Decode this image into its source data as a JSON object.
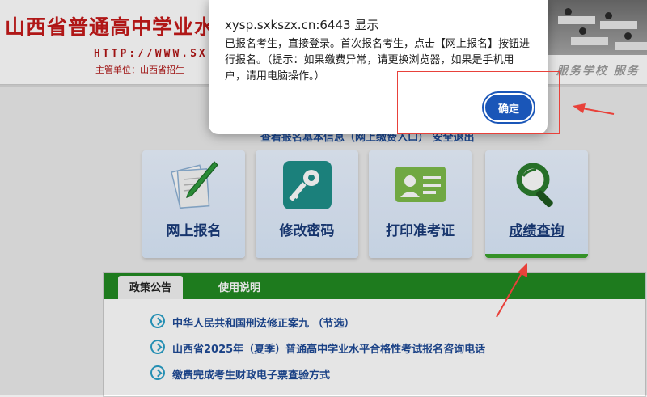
{
  "header": {
    "site_title": "山西省普通高中学业水",
    "site_url": "HTTP://WWW.SX",
    "host_line": "主管单位：山西省招生",
    "slogan": "服务学校  服务"
  },
  "hidden_links": "查看报名基本信息（网上缴费入口）     安全退出",
  "cards": [
    {
      "label": "网上报名",
      "icon": "pen-paper-icon"
    },
    {
      "label": "修改密码",
      "icon": "key-icon"
    },
    {
      "label": "打印准考证",
      "icon": "id-card-icon"
    },
    {
      "label": "成绩查询",
      "icon": "magnifier-icon"
    }
  ],
  "panel": {
    "tabs": [
      "政策公告",
      "使用说明"
    ],
    "news": [
      "中华人民共和国刑法修正案九 （节选）",
      "山西省2025年（夏季）普通高中学业水平合格性考试报名咨询电话",
      "缴费完成考生财政电子票查验方式"
    ]
  },
  "dialog": {
    "title": "xysp.sxkszx.cn:6443 显示",
    "message": "已报名考生，直接登录。首次报名考生，点击【网上报名】按钮进行报名。（提示：如果缴费异常，请更换浏览器，如果是手机用户，请用电脑操作。）",
    "ok_label": "确定"
  },
  "colors": {
    "brand_red": "#c41a1a",
    "panel_green": "#228a22",
    "card_accent_green": "#3aa22d",
    "button_blue": "#1a56b8",
    "annotation_red": "#e8413a"
  }
}
